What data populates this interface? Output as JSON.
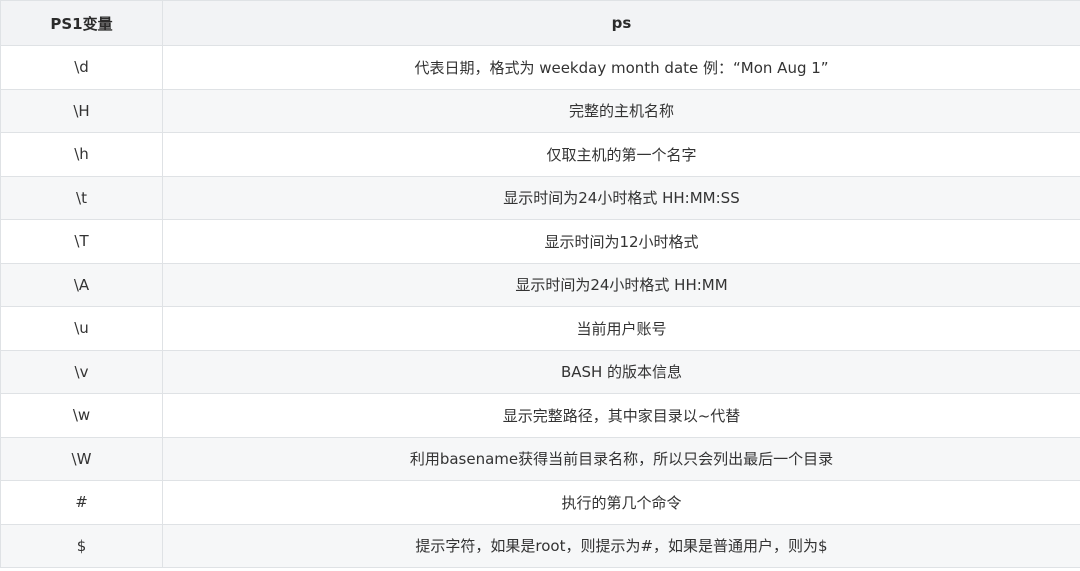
{
  "table": {
    "headers": [
      "PS1变量",
      "ps"
    ],
    "rows": [
      {
        "var": "\\d",
        "desc": "代表日期，格式为 weekday month date 例：“Mon Aug 1”"
      },
      {
        "var": "\\H",
        "desc": "完整的主机名称"
      },
      {
        "var": "\\h",
        "desc": "仅取主机的第一个名字"
      },
      {
        "var": "\\t",
        "desc": "显示时间为24小时格式 HH:MM:SS"
      },
      {
        "var": "\\T",
        "desc": "显示时间为12小时格式"
      },
      {
        "var": "\\A",
        "desc": "显示时间为24小时格式 HH:MM"
      },
      {
        "var": "\\u",
        "desc": "当前用户账号"
      },
      {
        "var": "\\v",
        "desc": "BASH 的版本信息"
      },
      {
        "var": "\\w",
        "desc": "显示完整路径，其中家目录以~代替"
      },
      {
        "var": "\\W",
        "desc": "利用basename获得当前目录名称，所以只会列出最后一个目录"
      },
      {
        "var": "#",
        "desc": "执行的第几个命令"
      },
      {
        "var": "$",
        "desc": "提示字符，如果是root，则提示为#，如果是普通用户，则为$"
      }
    ]
  }
}
